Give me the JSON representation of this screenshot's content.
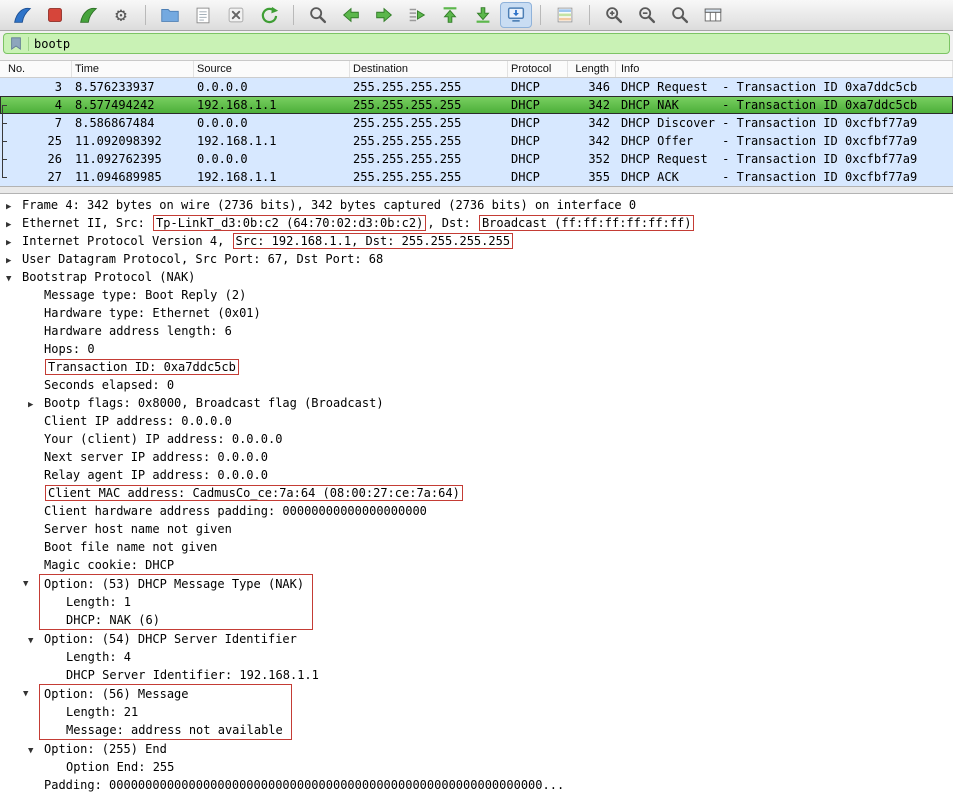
{
  "colors": {
    "selected_row_green": "#4aad37",
    "row_blue": "#d7e8ff",
    "filter_green": "#c9f2b5",
    "annotation_red": "#c43c35"
  },
  "toolbar": {
    "icons": [
      "start-capture-fin",
      "stop-capture-square",
      "restart-capture-fin",
      "capture-options-gear",
      "open-file-folder",
      "save-file-notepad",
      "close-file-x",
      "reload-arrows",
      "find-magnifier",
      "go-back-arrow",
      "go-forward-arrow",
      "go-to-packet-arrow",
      "go-first-arrow",
      "go-last-arrow",
      "auto-scroll-screen",
      "colorize-list",
      "zoom-in-magnifier",
      "zoom-out-magnifier",
      "zoom-normal-magnifier",
      "resize-columns-table"
    ]
  },
  "filter": {
    "value": "bootp"
  },
  "packet_list": {
    "columns": [
      {
        "key": "no",
        "label": "No."
      },
      {
        "key": "time",
        "label": "Time"
      },
      {
        "key": "source",
        "label": "Source"
      },
      {
        "key": "destination",
        "label": "Destination"
      },
      {
        "key": "protocol",
        "label": "Protocol"
      },
      {
        "key": "length",
        "label": "Length"
      },
      {
        "key": "info",
        "label": "Info"
      }
    ],
    "rows": [
      {
        "no": "3",
        "time": "8.576233937",
        "source": "0.0.0.0",
        "destination": "255.255.255.255",
        "protocol": "DHCP",
        "length": "346",
        "info": "DHCP Request  - Transaction ID 0xa7ddc5cb",
        "selected": false
      },
      {
        "no": "4",
        "time": "8.577494242",
        "source": "192.168.1.1",
        "destination": "255.255.255.255",
        "protocol": "DHCP",
        "length": "342",
        "info": "DHCP NAK      - Transaction ID 0xa7ddc5cb",
        "selected": true
      },
      {
        "no": "7",
        "time": "8.586867484",
        "source": "0.0.0.0",
        "destination": "255.255.255.255",
        "protocol": "DHCP",
        "length": "342",
        "info": "DHCP Discover - Transaction ID 0xcfbf77a9",
        "selected": false
      },
      {
        "no": "25",
        "time": "11.092098392",
        "source": "192.168.1.1",
        "destination": "255.255.255.255",
        "protocol": "DHCP",
        "length": "342",
        "info": "DHCP Offer    - Transaction ID 0xcfbf77a9",
        "selected": false
      },
      {
        "no": "26",
        "time": "11.092762395",
        "source": "0.0.0.0",
        "destination": "255.255.255.255",
        "protocol": "DHCP",
        "length": "352",
        "info": "DHCP Request  - Transaction ID 0xcfbf77a9",
        "selected": false
      },
      {
        "no": "27",
        "time": "11.094689985",
        "source": "192.168.1.1",
        "destination": "255.255.255.255",
        "protocol": "DHCP",
        "length": "355",
        "info": "DHCP ACK      - Transaction ID 0xcfbf77a9",
        "selected": false
      }
    ]
  },
  "detail": {
    "lines": [
      {
        "indent": 0,
        "arrow": "collapsed",
        "text": "Frame 4: 342 bytes on wire (2736 bits), 342 bytes captured (2736 bits) on interface 0"
      },
      {
        "indent": 0,
        "arrow": "collapsed",
        "parts": [
          {
            "t": "Ethernet II, Src: "
          },
          {
            "t": "Tp-LinkT_d3:0b:c2 (64:70:02:d3:0b:c2)",
            "box": true
          },
          {
            "t": ", Dst: "
          },
          {
            "t": "Broadcast (ff:ff:ff:ff:ff:ff)",
            "box": true
          }
        ]
      },
      {
        "indent": 0,
        "arrow": "collapsed",
        "parts": [
          {
            "t": "Internet Protocol Version 4, "
          },
          {
            "t": "Src: 192.168.1.1, Dst: 255.255.255.255",
            "box": true
          }
        ]
      },
      {
        "indent": 0,
        "arrow": "collapsed",
        "text": "User Datagram Protocol, Src Port: 67, Dst Port: 68"
      },
      {
        "indent": 0,
        "arrow": "expanded",
        "text": "Bootstrap Protocol (NAK)"
      },
      {
        "indent": 1,
        "text": "Message type: Boot Reply (2)"
      },
      {
        "indent": 1,
        "text": "Hardware type: Ethernet (0x01)"
      },
      {
        "indent": 1,
        "text": "Hardware address length: 6"
      },
      {
        "indent": 1,
        "text": "Hops: 0"
      },
      {
        "indent": 1,
        "parts": [
          {
            "t": "Transaction ID: 0xa7ddc5cb",
            "box": true
          }
        ]
      },
      {
        "indent": 1,
        "text": "Seconds elapsed: 0"
      },
      {
        "indent": 1,
        "arrow": "collapsed",
        "text": "Bootp flags: 0x8000, Broadcast flag (Broadcast)"
      },
      {
        "indent": 1,
        "text": "Client IP address: 0.0.0.0"
      },
      {
        "indent": 1,
        "text": "Your (client) IP address: 0.0.0.0"
      },
      {
        "indent": 1,
        "text": "Next server IP address: 0.0.0.0"
      },
      {
        "indent": 1,
        "text": "Relay agent IP address: 0.0.0.0"
      },
      {
        "indent": 1,
        "parts": [
          {
            "t": "Client MAC address: CadmusCo_ce:7a:64 (08:00:27:ce:7a:64)",
            "box": true
          }
        ]
      },
      {
        "indent": 1,
        "text": "Client hardware address padding: 00000000000000000000"
      },
      {
        "indent": 1,
        "text": "Server host name not given"
      },
      {
        "indent": 1,
        "text": "Boot file name not given"
      },
      {
        "indent": 1,
        "text": "Magic cookie: DHCP"
      },
      {
        "group": true,
        "indent": 1,
        "lines": [
          {
            "indent": 1,
            "arrow": "expanded",
            "text": "Option: (53) DHCP Message Type (NAK)"
          },
          {
            "indent": 2,
            "text": "Length: 1"
          },
          {
            "indent": 2,
            "text": "DHCP: NAK (6)"
          }
        ]
      },
      {
        "indent": 1,
        "arrow": "expanded",
        "text": "Option: (54) DHCP Server Identifier"
      },
      {
        "indent": 2,
        "text": "Length: 4"
      },
      {
        "indent": 2,
        "text": "DHCP Server Identifier: 192.168.1.1"
      },
      {
        "group": true,
        "indent": 1,
        "lines": [
          {
            "indent": 1,
            "arrow": "expanded",
            "text": "Option: (56) Message"
          },
          {
            "indent": 2,
            "text": "Length: 21"
          },
          {
            "indent": 2,
            "text": "Message: address not available"
          }
        ]
      },
      {
        "indent": 1,
        "arrow": "expanded",
        "text": "Option: (255) End"
      },
      {
        "indent": 2,
        "text": "Option End: 255"
      },
      {
        "indent": 1,
        "text": "Padding: 000000000000000000000000000000000000000000000000000000000000..."
      }
    ]
  }
}
